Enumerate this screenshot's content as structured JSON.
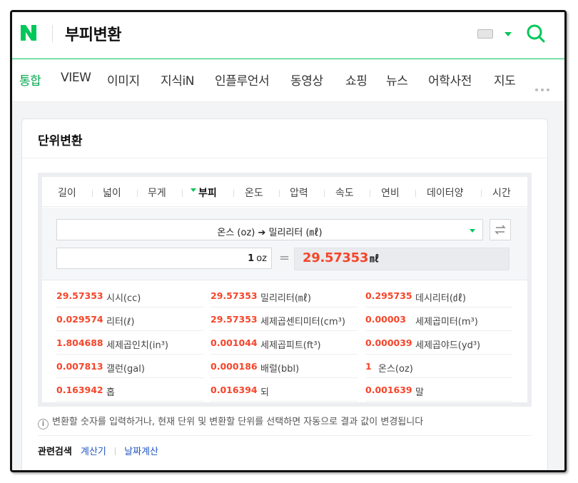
{
  "header": {
    "logo": "N",
    "query": "부피변환",
    "brand_color": "#03c75a"
  },
  "tabs": [
    {
      "label": "통합",
      "active": true
    },
    {
      "label": "VIEW"
    },
    {
      "label": "이미지"
    },
    {
      "label": "지식iN"
    },
    {
      "label": "인플루언서"
    },
    {
      "label": "동영상"
    },
    {
      "label": "쇼핑"
    },
    {
      "label": "뉴스"
    },
    {
      "label": "어학사전"
    },
    {
      "label": "지도"
    }
  ],
  "card": {
    "title": "단위변환"
  },
  "unit_tabs": [
    {
      "label": "길이"
    },
    {
      "label": "넓이"
    },
    {
      "label": "무게"
    },
    {
      "label": "부피",
      "active": true
    },
    {
      "label": "온도"
    },
    {
      "label": "압력"
    },
    {
      "label": "속도"
    },
    {
      "label": "연비"
    },
    {
      "label": "데이터양"
    },
    {
      "label": "시간"
    }
  ],
  "converter": {
    "selection": "온스 (oz) ➔ 밀리리터 (㎖)",
    "input_value": "1",
    "input_unit": "oz",
    "equals": "=",
    "result_value": "29.57353",
    "result_unit": "㎖",
    "result_color": "#f5452a"
  },
  "results": [
    {
      "value": "29.57353",
      "unit": "시시(cc)"
    },
    {
      "value": "29.57353",
      "unit": "밀리리터(㎖)"
    },
    {
      "value": "0.295735",
      "unit": "데시리터(㎗)"
    },
    {
      "value": "0.029574",
      "unit": "리터(ℓ)"
    },
    {
      "value": "29.57353",
      "unit": "세제곱센티미터(cm³)"
    },
    {
      "value": "0.00003",
      "unit": "세제곱미터(m³)"
    },
    {
      "value": "1.804688",
      "unit": "세제곱인치(in³)"
    },
    {
      "value": "0.001044",
      "unit": "세제곱피트(ft³)"
    },
    {
      "value": "0.000039",
      "unit": "세제곱야드(yd³)"
    },
    {
      "value": "0.007813",
      "unit": "갤런(gal)"
    },
    {
      "value": "0.000186",
      "unit": "배럴(bbl)"
    },
    {
      "value": "1",
      "unit": "온스(oz)"
    },
    {
      "value": "0.163942",
      "unit": "홉"
    },
    {
      "value": "0.016394",
      "unit": "되"
    },
    {
      "value": "0.001639",
      "unit": "말"
    }
  ],
  "note": {
    "icon": "i",
    "text": "변환할 숫자를 입력하거나, 현재 단위 및 변환할 단위를 선택하면 자동으로 결과 값이 변경됩니다"
  },
  "related": {
    "label": "관련검색",
    "links": [
      "계산기",
      "날짜계산"
    ]
  }
}
